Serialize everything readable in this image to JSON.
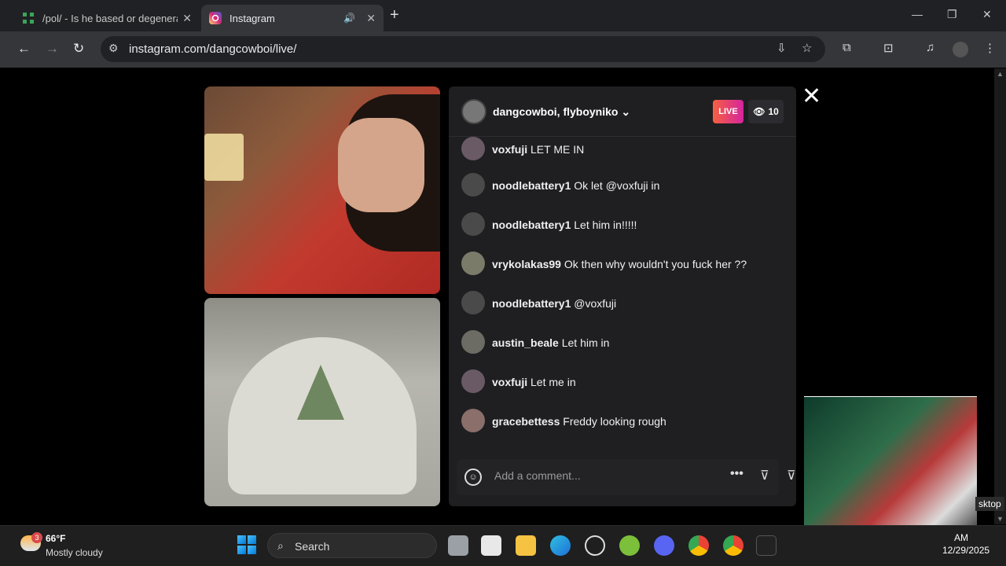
{
  "browser": {
    "tabs": [
      {
        "title": "/pol/ - Is he based or degenera",
        "active": false
      },
      {
        "title": "Instagram",
        "active": true
      }
    ],
    "new_tab": "+",
    "url": "instagram.com/dangcowboi/live/"
  },
  "live": {
    "hosts": "dangcowboi, flyboyniko",
    "badge": "LIVE",
    "viewers": "10",
    "comments": [
      {
        "user": "voxfuji",
        "text": "LET ME IN"
      },
      {
        "user": "noodlebattery1",
        "text": "Ok let @voxfuji in"
      },
      {
        "user": "noodlebattery1",
        "text": "Let him in!!!!!"
      },
      {
        "user": "vrykolakas99",
        "text": "Ok then why wouldn't you fuck her ??"
      },
      {
        "user": "noodlebattery1",
        "text": "@voxfuji"
      },
      {
        "user": "austin_beale",
        "text": "Let him in"
      },
      {
        "user": "voxfuji",
        "text": "Let me in"
      },
      {
        "user": "gracebettess",
        "text": "Freddy looking rough"
      }
    ],
    "comment_placeholder": "Add a comment..."
  },
  "taskbar": {
    "weather_temp": "66°F",
    "weather_desc": "Mostly cloudy",
    "weather_badge": "3",
    "search_label": "Search",
    "overlay_text": "sktop",
    "time": "AM",
    "date": "12/29/2025"
  },
  "colors": {
    "live_gradient_start": "#f56040",
    "live_gradient_end": "#d6249f",
    "panel_bg": "#1f1f22"
  }
}
